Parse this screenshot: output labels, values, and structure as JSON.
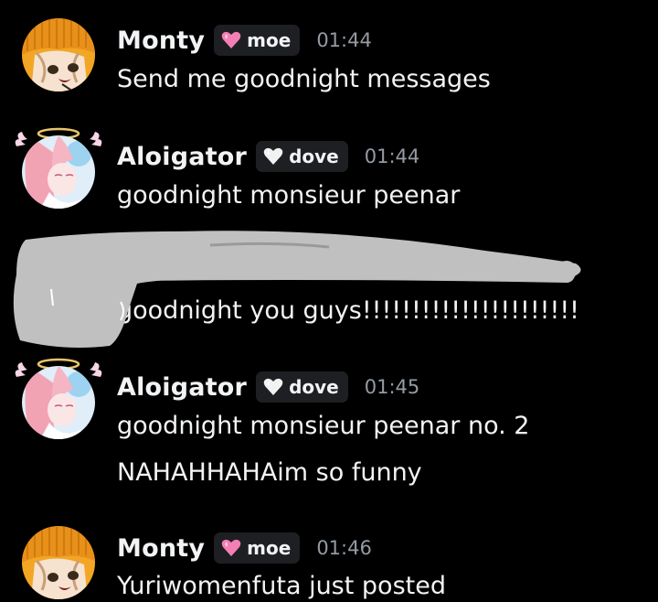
{
  "messages": [
    {
      "username": "Monty",
      "tag": "moe",
      "time": "01:44",
      "lines": [
        "Send me goodnight messages"
      ]
    },
    {
      "username": "Aloigator",
      "tag": "dove",
      "time": "01:44",
      "lines": [
        "goodnight monsieur peenar"
      ]
    },
    {
      "lines": [
        "goodnight you guys!!!!!!!!!!!!!!!!!!!!!!"
      ]
    },
    {
      "username": "Aloigator",
      "tag": "dove",
      "time": "01:45",
      "lines": [
        "goodnight monsieur peenar no. 2",
        "NAHAHHAHAim so funny"
      ]
    },
    {
      "username": "Monty",
      "tag": "moe",
      "time": "01:46",
      "lines": [
        "Yuriwomenfuta just posted"
      ]
    }
  ],
  "icons": {
    "moe_tag": "pink-heart-icon",
    "dove_tag": "white-heart-icon"
  },
  "colors": {
    "background": "#000000",
    "text": "#f2f3f5",
    "timestamp": "#949ba4",
    "tag_bg": "#1e1f22",
    "pink_heart": "#f47fb5",
    "redaction": "#c0c0c0"
  }
}
